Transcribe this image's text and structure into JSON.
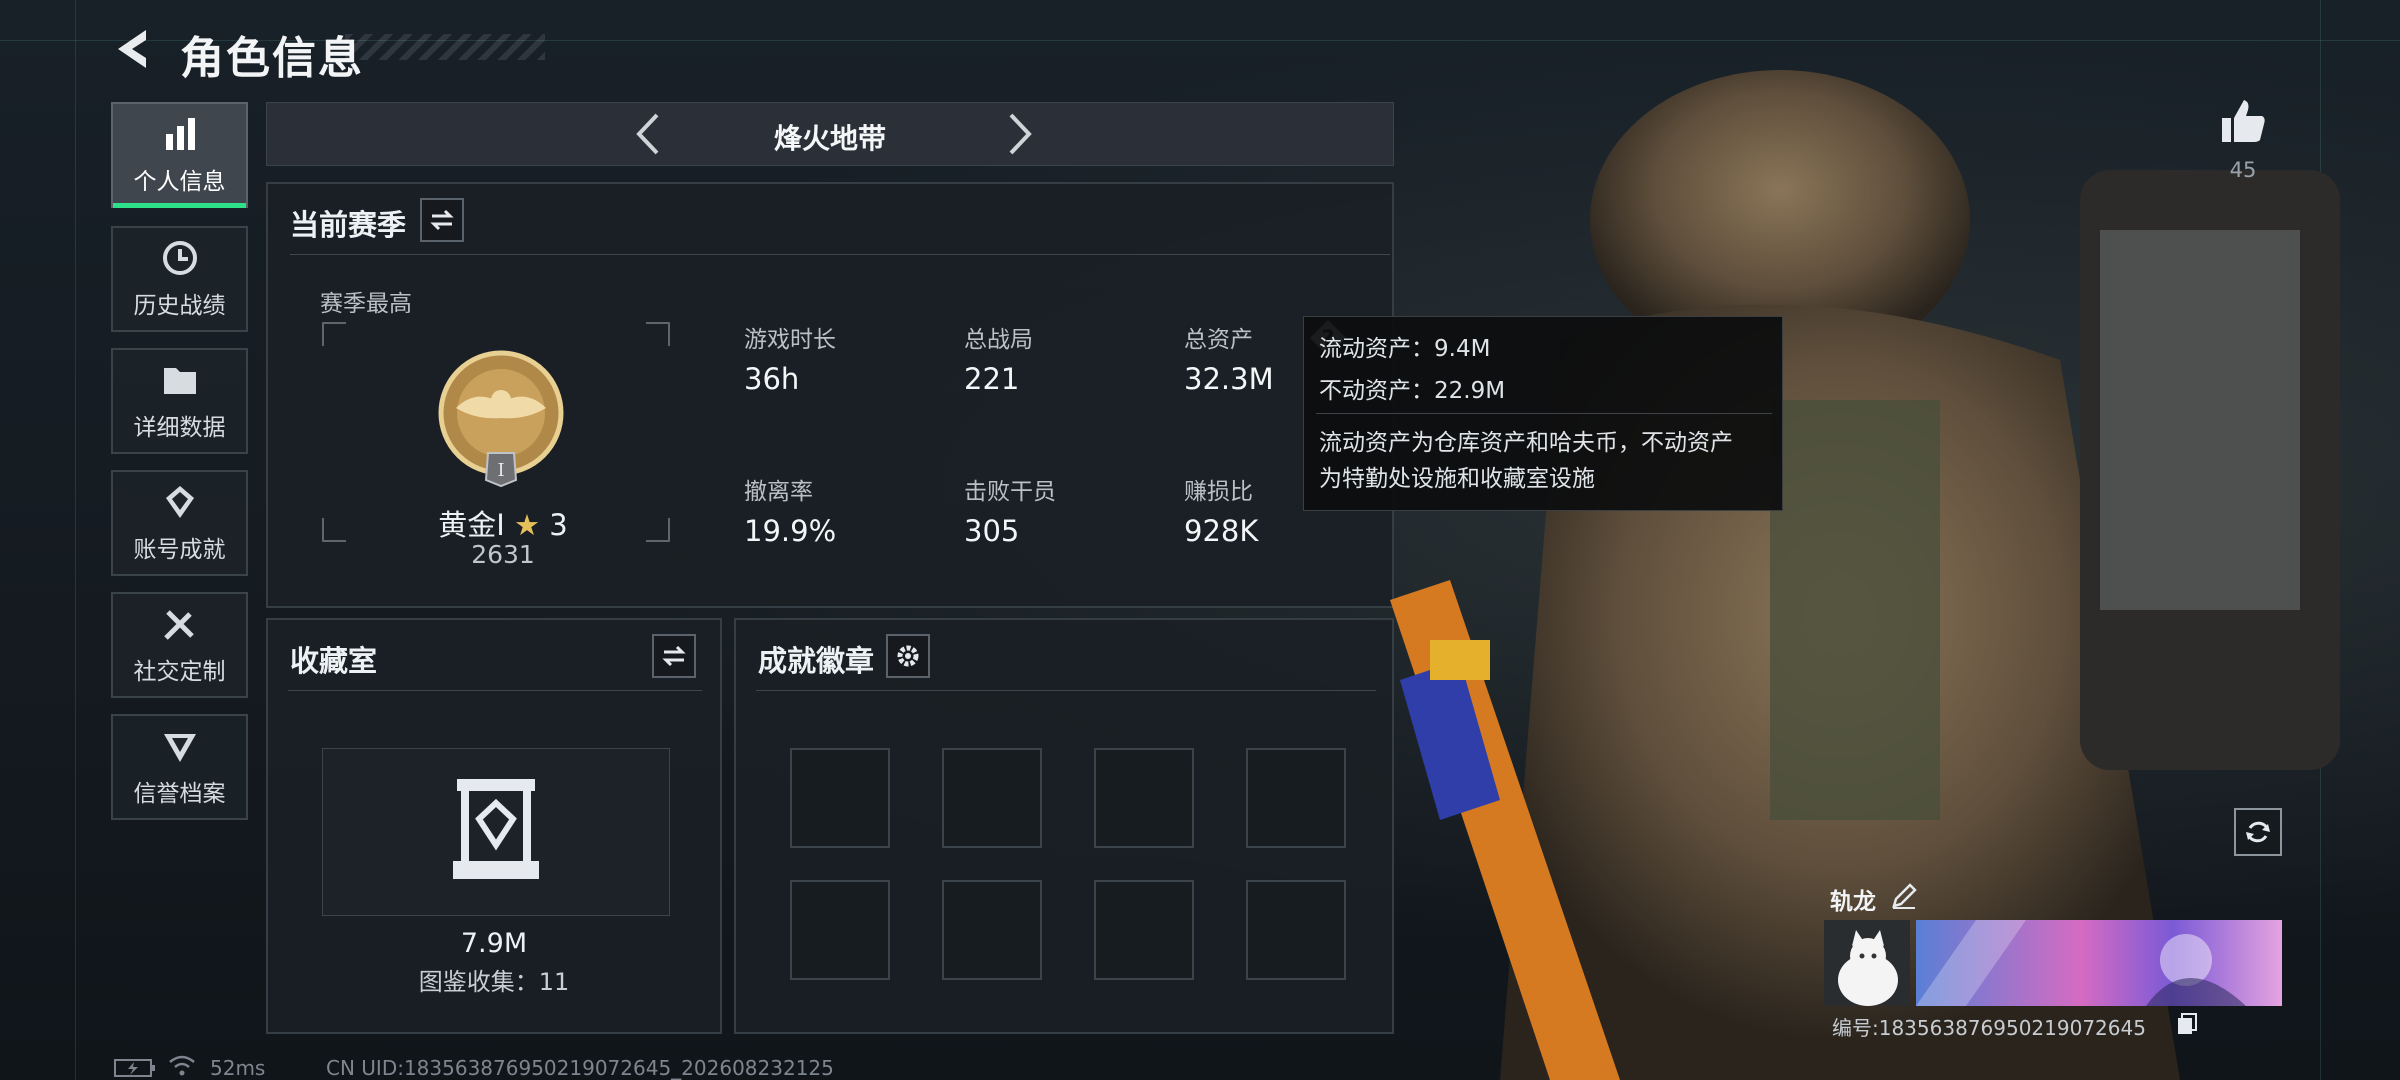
{
  "header": {
    "title": "角色信息"
  },
  "nav": [
    {
      "label": "个人信息",
      "icon": "bar-chart-icon",
      "active": true
    },
    {
      "label": "历史战绩",
      "icon": "history-icon",
      "active": false
    },
    {
      "label": "详细数据",
      "icon": "folder-icon",
      "active": false
    },
    {
      "label": "账号成就",
      "icon": "achievement-icon",
      "active": false
    },
    {
      "label": "社交定制",
      "icon": "tools-icon",
      "active": false
    },
    {
      "label": "信誉档案",
      "icon": "reputation-icon",
      "active": false
    }
  ],
  "mode": {
    "title": "烽火地带"
  },
  "season": {
    "title": "当前赛季",
    "best_label": "赛季最高",
    "rank_name": "黄金I",
    "rank_stars": "3",
    "rank_score": "2631",
    "badge_numeral": "I",
    "stats": [
      {
        "label": "游戏时长",
        "value": "36h"
      },
      {
        "label": "总战局",
        "value": "221"
      },
      {
        "label": "总资产",
        "value": "32.3M"
      },
      {
        "label": "撤离率",
        "value": "19.9%"
      },
      {
        "label": "击败干员",
        "value": "305"
      },
      {
        "label": "赚损比",
        "value": "928K"
      }
    ]
  },
  "tooltip": {
    "liquid": "流动资产：9.4M",
    "fixed": "不动资产：22.9M",
    "desc_line1": "流动资产为仓库资产和哈夫币，不动资产",
    "desc_line2": "为特勤处设施和收藏室设施"
  },
  "collection": {
    "title": "收藏室",
    "value": "7.9M",
    "catalog": "图鉴收集：11"
  },
  "achievements": {
    "title": "成就徽章",
    "slots": 8
  },
  "likes": {
    "count": "45"
  },
  "player": {
    "name": "轨龙",
    "id": "编号:18356387695021907264​5"
  },
  "status": {
    "ping": "52ms",
    "uid": "CN UID:183563876950219072645_202608232125"
  },
  "colors": {
    "accent": "#2ee08a",
    "panel": "#1a1f25",
    "border": "#353d45"
  }
}
